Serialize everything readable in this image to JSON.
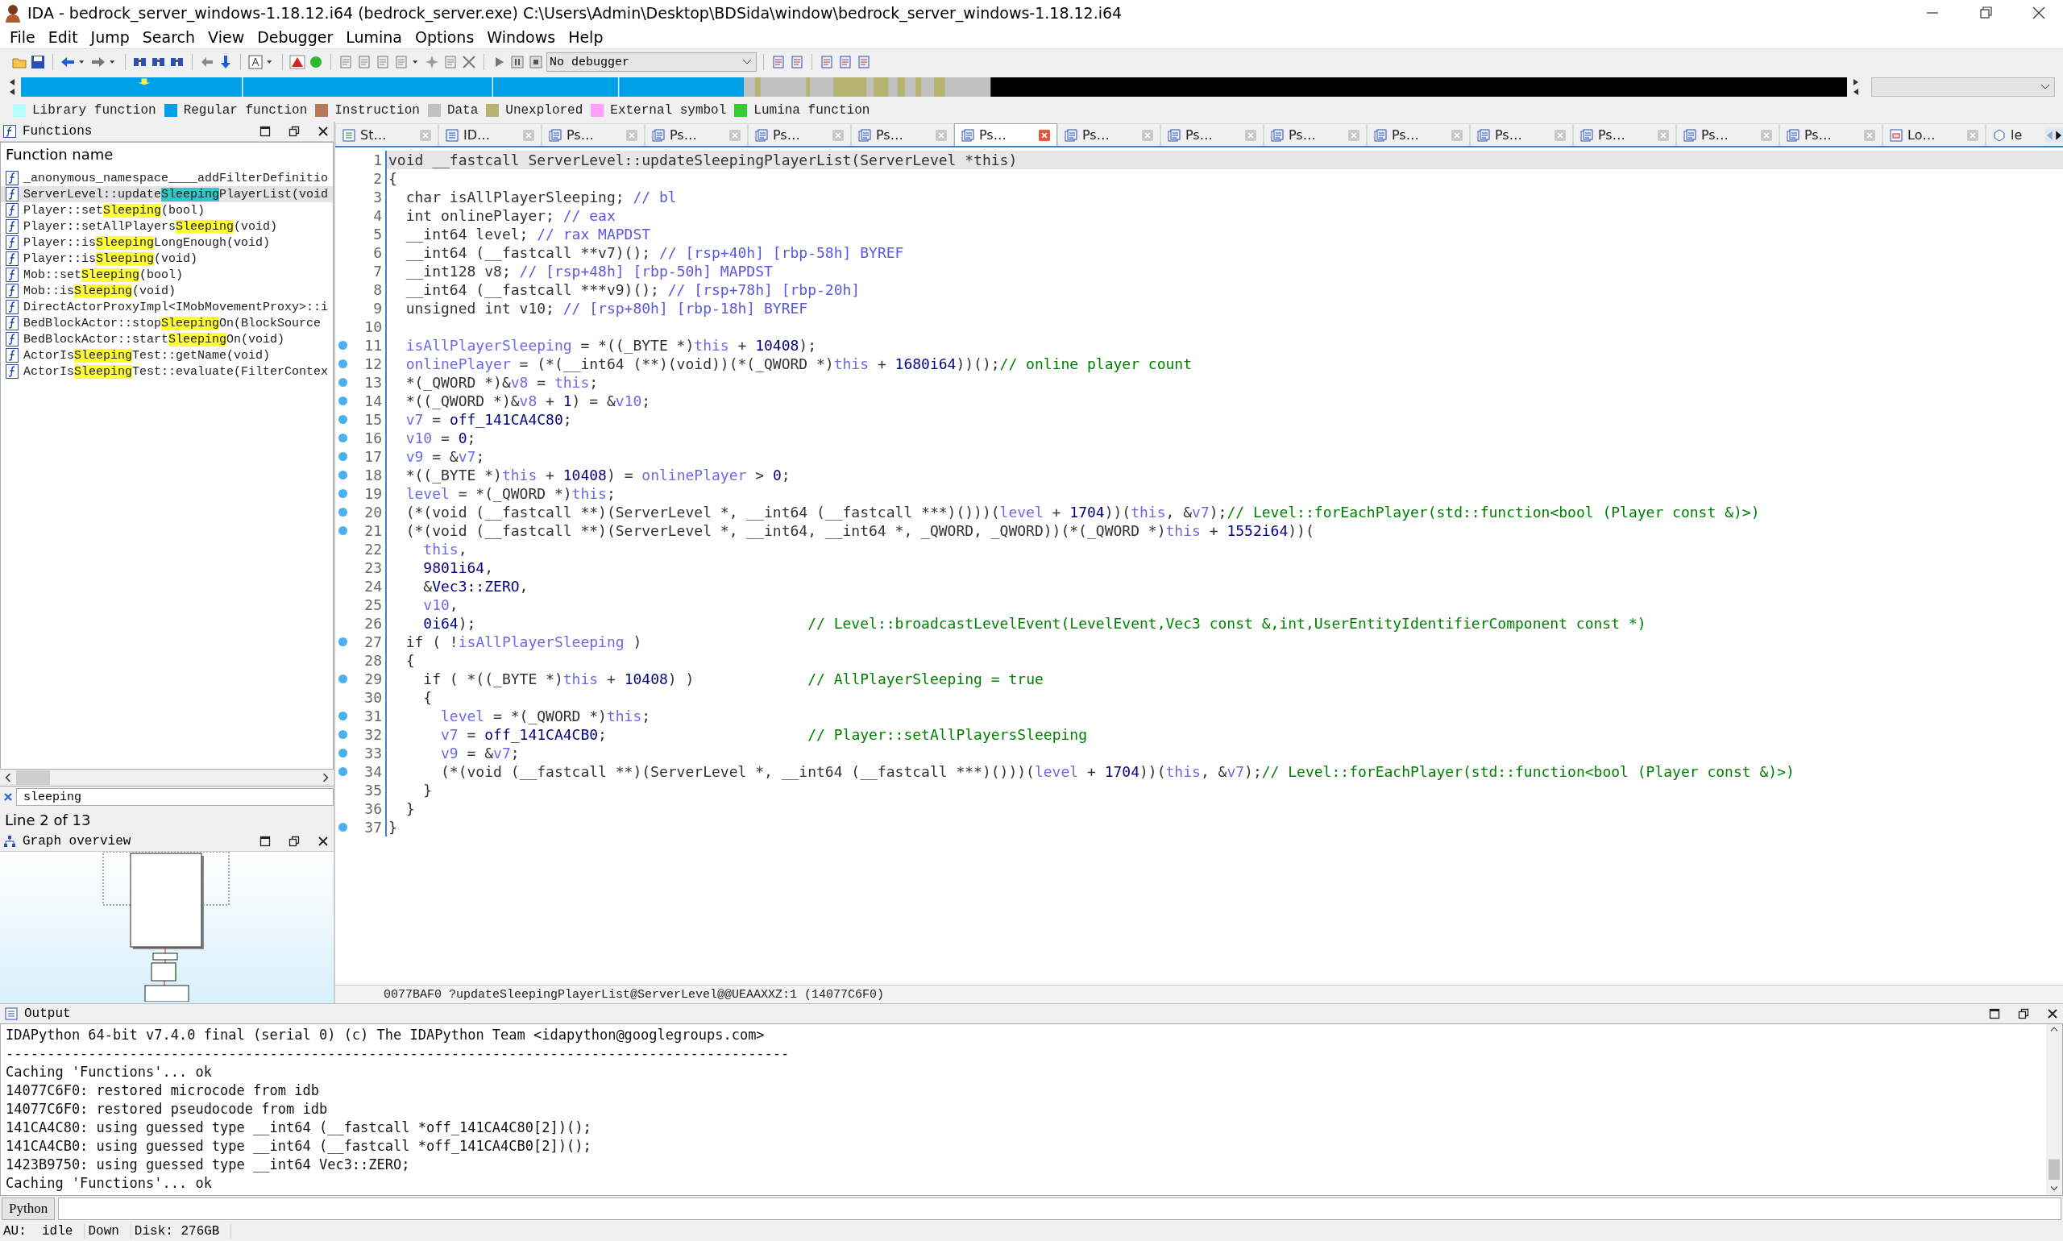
{
  "window": {
    "title": "IDA - bedrock_server_windows-1.18.12.i64 (bedrock_server.exe) C:\\Users\\Admin\\Desktop\\BDSida\\window\\bedrock_server_windows-1.18.12.i64"
  },
  "menu": [
    "File",
    "Edit",
    "Jump",
    "Search",
    "View",
    "Debugger",
    "Lumina",
    "Options",
    "Windows",
    "Help"
  ],
  "toolbar": {
    "debugger": "No debugger"
  },
  "legend": [
    {
      "label": "Library function",
      "color": "#b3ffff"
    },
    {
      "label": "Regular function",
      "color": "#00a0e8"
    },
    {
      "label": "Instruction",
      "color": "#b8785a"
    },
    {
      "label": "Data",
      "color": "#c0c0c0"
    },
    {
      "label": "Unexplored",
      "color": "#b4b470"
    },
    {
      "label": "External symbol",
      "color": "#ffa0ff"
    },
    {
      "label": "Lumina function",
      "color": "#33cc33"
    }
  ],
  "functions_panel": {
    "title": "Functions",
    "column": "Function name",
    "items": [
      {
        "before": "_anonymous_namespace____addFilterDefinitio",
        "selected": false
      },
      {
        "before": "ServerLevel::update",
        "match": "Sleeping",
        "after": "PlayerList(void",
        "selected": true
      },
      {
        "before": "Player::set",
        "match": "Sleeping",
        "after": "(bool)",
        "selected": false
      },
      {
        "before": "Player::setAllPlayers",
        "match": "Sleeping",
        "after": "(void)",
        "selected": false
      },
      {
        "before": "Player::is",
        "match": "Sleeping",
        "after": "LongEnough(void)",
        "selected": false
      },
      {
        "before": "Player::is",
        "match": "Sleeping",
        "after": "(void)",
        "selected": false
      },
      {
        "before": "Mob::set",
        "match": "Sleeping",
        "after": "(bool)",
        "selected": false
      },
      {
        "before": "Mob::is",
        "match": "Sleeping",
        "after": "(void)",
        "selected": false
      },
      {
        "before": "DirectActorProxyImpl<IMobMovementProxy>::i",
        "selected": false
      },
      {
        "before": "BedBlockActor::stop",
        "match": "Sleeping",
        "after": "On(BlockSource",
        "selected": false
      },
      {
        "before": "BedBlockActor::start",
        "match": "Sleeping",
        "after": "On(void)",
        "selected": false
      },
      {
        "before": "ActorIs",
        "match": "Sleeping",
        "after": "Test::getName(void)",
        "selected": false
      },
      {
        "before": "ActorIs",
        "match": "Sleeping",
        "after": "Test::evaluate(FilterContex",
        "selected": false
      }
    ],
    "filter": "sleeping",
    "line_info": "Line 2 of 13"
  },
  "graph_overview": {
    "title": "Graph overview"
  },
  "tabs": [
    {
      "label": "St…",
      "kind": "structures",
      "selected": false
    },
    {
      "label": "ID…",
      "kind": "list",
      "selected": false
    },
    {
      "label": "Ps…",
      "kind": "pseudocode",
      "selected": false
    },
    {
      "label": "Ps…",
      "kind": "pseudocode",
      "selected": false
    },
    {
      "label": "Ps…",
      "kind": "pseudocode",
      "selected": false
    },
    {
      "label": "Ps…",
      "kind": "pseudocode",
      "selected": false
    },
    {
      "label": "Ps…",
      "kind": "pseudocode",
      "selected": true
    },
    {
      "label": "Ps…",
      "kind": "pseudocode",
      "selected": false
    },
    {
      "label": "Ps…",
      "kind": "pseudocode",
      "selected": false
    },
    {
      "label": "Ps…",
      "kind": "pseudocode",
      "selected": false
    },
    {
      "label": "Ps…",
      "kind": "pseudocode",
      "selected": false
    },
    {
      "label": "Ps…",
      "kind": "pseudocode",
      "selected": false
    },
    {
      "label": "Ps…",
      "kind": "pseudocode",
      "selected": false
    },
    {
      "label": "Ps…",
      "kind": "pseudocode",
      "selected": false
    },
    {
      "label": "Ps…",
      "kind": "pseudocode",
      "selected": false
    },
    {
      "label": "Lo…",
      "kind": "types",
      "selected": false
    },
    {
      "label": "le",
      "kind": "hex",
      "selected": false
    }
  ],
  "pseudocode": {
    "lines": [
      {
        "number": "1",
        "breakpoint": false,
        "current": true,
        "tokens": [
          {
            "kind": "plain",
            "text": "void __fastcall ServerLevel::updateSleepingPlayerList(ServerLevel *this)"
          }
        ]
      },
      {
        "number": "2",
        "breakpoint": false,
        "current": false,
        "tokens": [
          {
            "kind": "plain",
            "text": "{"
          }
        ]
      },
      {
        "number": "3",
        "breakpoint": false,
        "current": false,
        "tokens": [
          {
            "kind": "plain",
            "text": "  char isAllPlayerSleeping; "
          },
          {
            "kind": "reg",
            "text": "// bl"
          }
        ]
      },
      {
        "number": "4",
        "breakpoint": false,
        "current": false,
        "tokens": [
          {
            "kind": "plain",
            "text": "  int onlinePlayer; "
          },
          {
            "kind": "reg",
            "text": "// eax"
          }
        ]
      },
      {
        "number": "5",
        "breakpoint": false,
        "current": false,
        "tokens": [
          {
            "kind": "plain",
            "text": "  __int64 level; "
          },
          {
            "kind": "reg",
            "text": "// rax MAPDST"
          }
        ]
      },
      {
        "number": "6",
        "breakpoint": false,
        "current": false,
        "tokens": [
          {
            "kind": "plain",
            "text": "  __int64 (__fastcall **v7)(); "
          },
          {
            "kind": "reg",
            "text": "// [rsp+40h] [rbp-58h] BYREF"
          }
        ]
      },
      {
        "number": "7",
        "breakpoint": false,
        "current": false,
        "tokens": [
          {
            "kind": "plain",
            "text": "  __int128 v8; "
          },
          {
            "kind": "reg",
            "text": "// [rsp+48h] [rbp-50h] MAPDST"
          }
        ]
      },
      {
        "number": "8",
        "breakpoint": false,
        "current": false,
        "tokens": [
          {
            "kind": "plain",
            "text": "  __int64 (__fastcall ***v9)(); "
          },
          {
            "kind": "reg",
            "text": "// [rsp+78h] [rbp-20h]"
          }
        ]
      },
      {
        "number": "9",
        "breakpoint": false,
        "current": false,
        "tokens": [
          {
            "kind": "plain",
            "text": "  unsigned int v10; "
          },
          {
            "kind": "reg",
            "text": "// [rsp+80h] [rbp-18h] BYREF"
          }
        ]
      },
      {
        "number": "10",
        "breakpoint": false,
        "current": false
      },
      {
        "number": "11",
        "breakpoint": true,
        "current": false,
        "tokens": [
          {
            "kind": "var",
            "text": "  isAllPlayerSleeping"
          },
          {
            "kind": "plain",
            "text": " = *((_BYTE *)"
          },
          {
            "kind": "var",
            "text": "this"
          },
          {
            "kind": "plain",
            "text": " + "
          },
          {
            "kind": "num",
            "text": "10408"
          },
          {
            "kind": "plain",
            "text": ");"
          }
        ]
      },
      {
        "number": "12",
        "breakpoint": true,
        "current": false,
        "tokens": [
          {
            "kind": "var",
            "text": "  onlinePlayer"
          },
          {
            "kind": "plain",
            "text": " = (*(__int64 (**)(void))(*(_QWORD *)"
          },
          {
            "kind": "var",
            "text": "this"
          },
          {
            "kind": "plain",
            "text": " + "
          },
          {
            "kind": "num",
            "text": "1680i64"
          },
          {
            "kind": "plain",
            "text": "))();"
          },
          {
            "kind": "comment",
            "text": "// online player count"
          }
        ]
      },
      {
        "number": "13",
        "breakpoint": true,
        "current": false,
        "tokens": [
          {
            "kind": "plain",
            "text": "  *(_QWORD *)&"
          },
          {
            "kind": "var",
            "text": "v8"
          },
          {
            "kind": "plain",
            "text": " = "
          },
          {
            "kind": "var",
            "text": "this"
          },
          {
            "kind": "plain",
            "text": ";"
          }
        ]
      },
      {
        "number": "14",
        "breakpoint": true,
        "current": false,
        "tokens": [
          {
            "kind": "plain",
            "text": "  *((_QWORD *)&"
          },
          {
            "kind": "var",
            "text": "v8"
          },
          {
            "kind": "plain",
            "text": " + "
          },
          {
            "kind": "num",
            "text": "1"
          },
          {
            "kind": "plain",
            "text": ") = &"
          },
          {
            "kind": "var",
            "text": "v10"
          },
          {
            "kind": "plain",
            "text": ";"
          }
        ]
      },
      {
        "number": "15",
        "breakpoint": true,
        "current": false,
        "tokens": [
          {
            "kind": "var",
            "text": "  v7"
          },
          {
            "kind": "plain",
            "text": " = "
          },
          {
            "kind": "num",
            "text": "off_141CA4C80"
          },
          {
            "kind": "plain",
            "text": ";"
          }
        ]
      },
      {
        "number": "16",
        "breakpoint": true,
        "current": false,
        "tokens": [
          {
            "kind": "var",
            "text": "  v10"
          },
          {
            "kind": "plain",
            "text": " = "
          },
          {
            "kind": "num",
            "text": "0"
          },
          {
            "kind": "plain",
            "text": ";"
          }
        ]
      },
      {
        "number": "17",
        "breakpoint": true,
        "current": false,
        "tokens": [
          {
            "kind": "var",
            "text": "  v9"
          },
          {
            "kind": "plain",
            "text": " = &"
          },
          {
            "kind": "var",
            "text": "v7"
          },
          {
            "kind": "plain",
            "text": ";"
          }
        ]
      },
      {
        "number": "18",
        "breakpoint": true,
        "current": false,
        "tokens": [
          {
            "kind": "plain",
            "text": "  *((_BYTE *)"
          },
          {
            "kind": "var",
            "text": "this"
          },
          {
            "kind": "plain",
            "text": " + "
          },
          {
            "kind": "num",
            "text": "10408"
          },
          {
            "kind": "plain",
            "text": ") = "
          },
          {
            "kind": "var",
            "text": "onlinePlayer"
          },
          {
            "kind": "plain",
            "text": " > "
          },
          {
            "kind": "num",
            "text": "0"
          },
          {
            "kind": "plain",
            "text": ";"
          }
        ]
      },
      {
        "number": "19",
        "breakpoint": true,
        "current": false,
        "tokens": [
          {
            "kind": "var",
            "text": "  level"
          },
          {
            "kind": "plain",
            "text": " = *(_QWORD *)"
          },
          {
            "kind": "var",
            "text": "this"
          },
          {
            "kind": "plain",
            "text": ";"
          }
        ]
      },
      {
        "number": "20",
        "breakpoint": true,
        "current": false,
        "tokens": [
          {
            "kind": "plain",
            "text": "  (*(void (__fastcall **)(ServerLevel *, __int64 (__fastcall ***)()))("
          },
          {
            "kind": "var",
            "text": "level"
          },
          {
            "kind": "plain",
            "text": " + "
          },
          {
            "kind": "num",
            "text": "1704"
          },
          {
            "kind": "plain",
            "text": "))("
          },
          {
            "kind": "var",
            "text": "this"
          },
          {
            "kind": "plain",
            "text": ", &"
          },
          {
            "kind": "var",
            "text": "v7"
          },
          {
            "kind": "plain",
            "text": ");"
          },
          {
            "kind": "comment",
            "text": "// Level::forEachPlayer(std::function<bool (Player const &)>)"
          }
        ]
      },
      {
        "number": "21",
        "breakpoint": true,
        "current": false,
        "tokens": [
          {
            "kind": "plain",
            "text": "  (*(void (__fastcall **)(ServerLevel *, __int64, __int64 *, _QWORD, _QWORD))(*(_QWORD *)"
          },
          {
            "kind": "var",
            "text": "this"
          },
          {
            "kind": "plain",
            "text": " + "
          },
          {
            "kind": "num",
            "text": "1552i64"
          },
          {
            "kind": "plain",
            "text": "))("
          }
        ]
      },
      {
        "number": "22",
        "breakpoint": false,
        "current": false,
        "tokens": [
          {
            "kind": "var",
            "text": "    this"
          },
          {
            "kind": "plain",
            "text": ","
          }
        ]
      },
      {
        "number": "23",
        "breakpoint": false,
        "current": false,
        "tokens": [
          {
            "kind": "num",
            "text": "    9801i64"
          },
          {
            "kind": "plain",
            "text": ","
          }
        ]
      },
      {
        "number": "24",
        "breakpoint": false,
        "current": false,
        "tokens": [
          {
            "kind": "plain",
            "text": "    &"
          },
          {
            "kind": "num",
            "text": "Vec3::ZERO"
          },
          {
            "kind": "plain",
            "text": ","
          }
        ]
      },
      {
        "number": "25",
        "breakpoint": false,
        "current": false,
        "tokens": [
          {
            "kind": "var",
            "text": "    v10"
          },
          {
            "kind": "plain",
            "text": ","
          }
        ]
      },
      {
        "number": "26",
        "breakpoint": false,
        "current": false,
        "tokens": [
          {
            "kind": "num",
            "text": "    0i64"
          },
          {
            "kind": "plain",
            "text": ");                                      "
          },
          {
            "kind": "comment",
            "text": "// Level::broadcastLevelEvent(LevelEvent,Vec3 const &,int,UserEntityIdentifierComponent const *)"
          }
        ]
      },
      {
        "number": "27",
        "breakpoint": true,
        "current": false,
        "tokens": [
          {
            "kind": "plain",
            "text": "  if ( !"
          },
          {
            "kind": "var",
            "text": "isAllPlayerSleeping"
          },
          {
            "kind": "plain",
            "text": " )"
          }
        ]
      },
      {
        "number": "28",
        "breakpoint": false,
        "current": false,
        "tokens": [
          {
            "kind": "plain",
            "text": "  {"
          }
        ]
      },
      {
        "number": "29",
        "breakpoint": true,
        "current": false,
        "tokens": [
          {
            "kind": "plain",
            "text": "    if ( *((_BYTE *)"
          },
          {
            "kind": "var",
            "text": "this"
          },
          {
            "kind": "plain",
            "text": " + "
          },
          {
            "kind": "num",
            "text": "10408"
          },
          {
            "kind": "plain",
            "text": ") )             "
          },
          {
            "kind": "comment",
            "text": "// AllPlayerSleeping = true"
          }
        ]
      },
      {
        "number": "30",
        "breakpoint": false,
        "current": false,
        "tokens": [
          {
            "kind": "plain",
            "text": "    {"
          }
        ]
      },
      {
        "number": "31",
        "breakpoint": true,
        "current": false,
        "tokens": [
          {
            "kind": "var",
            "text": "      level"
          },
          {
            "kind": "plain",
            "text": " = *(_QWORD *)"
          },
          {
            "kind": "var",
            "text": "this"
          },
          {
            "kind": "plain",
            "text": ";"
          }
        ]
      },
      {
        "number": "32",
        "breakpoint": true,
        "current": false,
        "tokens": [
          {
            "kind": "var",
            "text": "      v7"
          },
          {
            "kind": "plain",
            "text": " = "
          },
          {
            "kind": "num",
            "text": "off_141CA4CB0"
          },
          {
            "kind": "plain",
            "text": ";                       "
          },
          {
            "kind": "comment",
            "text": "// Player::setAllPlayersSleeping"
          }
        ]
      },
      {
        "number": "33",
        "breakpoint": true,
        "current": false,
        "tokens": [
          {
            "kind": "var",
            "text": "      v9"
          },
          {
            "kind": "plain",
            "text": " = &"
          },
          {
            "kind": "var",
            "text": "v7"
          },
          {
            "kind": "plain",
            "text": ";"
          }
        ]
      },
      {
        "number": "34",
        "breakpoint": true,
        "current": false,
        "tokens": [
          {
            "kind": "plain",
            "text": "      (*(void (__fastcall **)(ServerLevel *, __int64 (__fastcall ***)()))("
          },
          {
            "kind": "var",
            "text": "level"
          },
          {
            "kind": "plain",
            "text": " + "
          },
          {
            "kind": "num",
            "text": "1704"
          },
          {
            "kind": "plain",
            "text": "))("
          },
          {
            "kind": "var",
            "text": "this"
          },
          {
            "kind": "plain",
            "text": ", &"
          },
          {
            "kind": "var",
            "text": "v7"
          },
          {
            "kind": "plain",
            "text": ");"
          },
          {
            "kind": "comment",
            "text": "// Level::forEachPlayer(std::function<bool (Player const &)>)"
          }
        ]
      },
      {
        "number": "35",
        "breakpoint": false,
        "current": false,
        "tokens": [
          {
            "kind": "plain",
            "text": "    }"
          }
        ]
      },
      {
        "number": "36",
        "breakpoint": false,
        "current": false,
        "tokens": [
          {
            "kind": "plain",
            "text": "  }"
          }
        ]
      },
      {
        "number": "37",
        "breakpoint": true,
        "current": false,
        "tokens": [
          {
            "kind": "plain",
            "text": "}"
          }
        ]
      }
    ],
    "location": "0077BAF0 ?updateSleepingPlayerList@ServerLevel@@UEAAXXZ:1 (14077C6F0)"
  },
  "output": {
    "title": "Output",
    "lines": [
      "IDAPython 64-bit v7.4.0 final (serial 0) (c) The IDAPython Team <idapython@googlegroups.com>",
      "-----------------------------------------------------------------------------------------------",
      "Caching 'Functions'... ok",
      "14077C6F0: restored microcode from idb",
      "14077C6F0: restored pseudocode from idb",
      "141CA4C80: using guessed type __int64 (__fastcall *off_141CA4C80[2])();",
      "141CA4CB0: using guessed type __int64 (__fastcall *off_141CA4CB0[2])();",
      "1423B9750: using guessed type __int64 Vec3::ZERO;",
      "Caching 'Functions'... ok"
    ],
    "input_label": "Python"
  },
  "status_bar": [
    "AU:  idle",
    "Down",
    "Disk: 276GB"
  ]
}
